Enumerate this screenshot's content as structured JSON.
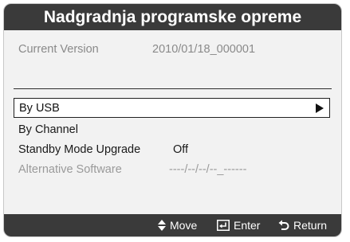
{
  "title": "Nadgradnja programske opreme",
  "current_version": {
    "label": "Current Version",
    "value": "2010/01/18_000001"
  },
  "menu": {
    "by_usb": "By USB",
    "by_channel": "By Channel",
    "standby_label": "Standby Mode Upgrade",
    "standby_value": "Off",
    "alternative_label": "Alternative Software",
    "alternative_value": "----/--/--/--_------"
  },
  "footer": {
    "move": "Move",
    "enter": "Enter",
    "return": "Return"
  },
  "colors": {
    "bar": "#3a3a3a",
    "panel": "#f2f2f2",
    "disabled_text": "#9a9a9a"
  },
  "icons": {
    "move": "up-down-arrows-icon",
    "enter": "enter-icon",
    "return": "return-icon",
    "submenu": "arrow-right-icon"
  }
}
